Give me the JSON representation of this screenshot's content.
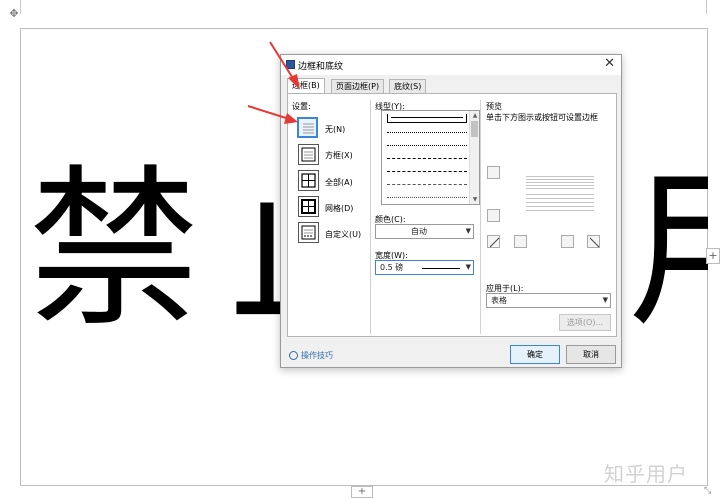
{
  "document": {
    "big_text": "禁止使用",
    "watermark": "知乎用户",
    "move_handle_icon": "move-handle-icon",
    "add_column_icon": "plus-icon",
    "add_row_icon": "plus-icon"
  },
  "dialog": {
    "title": "边框和底纹",
    "close_icon": "close-icon",
    "tabs": [
      {
        "label": "边框(B)",
        "active": true
      },
      {
        "label": "页面边框(P)",
        "active": false
      },
      {
        "label": "底纹(S)",
        "active": false
      }
    ],
    "settings": {
      "label": "设置:",
      "items": [
        {
          "label": "无(N)",
          "icon": "border-none-icon",
          "selected": true
        },
        {
          "label": "方框(X)",
          "icon": "border-box-icon",
          "selected": false
        },
        {
          "label": "全部(A)",
          "icon": "border-all-icon",
          "selected": false
        },
        {
          "label": "网格(D)",
          "icon": "border-grid-icon",
          "selected": false
        },
        {
          "label": "自定义(U)",
          "icon": "border-custom-icon",
          "selected": false
        }
      ]
    },
    "style": {
      "label": "线型(Y):"
    },
    "color": {
      "label": "颜色(C):",
      "value": "自动"
    },
    "width": {
      "label": "宽度(W):",
      "value": "0.5  磅"
    },
    "preview": {
      "label": "预览",
      "hint": "单击下方图示或按钮可设置边框"
    },
    "apply_to": {
      "label": "应用于(L):",
      "value": "表格"
    },
    "options_button": "选项(O)...",
    "tips_link": "操作技巧",
    "ok_button": "确定",
    "cancel_button": "取消"
  },
  "colors": {
    "accent": "#3a86d4",
    "arrow": "#e53935",
    "dialog_bg": "#f0f0f0"
  }
}
